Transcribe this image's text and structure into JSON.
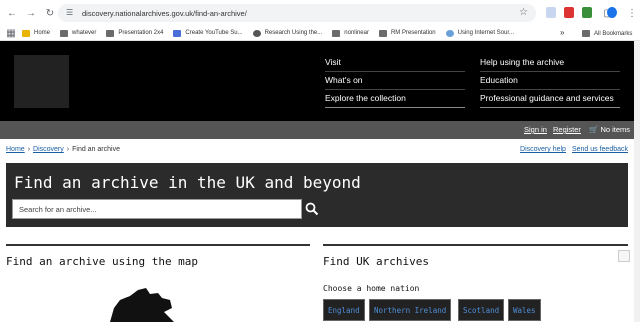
{
  "browser": {
    "url": "discovery.nationalarchives.gov.uk/find-an-archive/",
    "bookmarks": [
      {
        "label": "Home"
      },
      {
        "label": "whatever"
      },
      {
        "label": "Presentation 2x4"
      },
      {
        "label": "Create YouTube Su..."
      },
      {
        "label": "Research Using the..."
      },
      {
        "label": "nonlinear"
      },
      {
        "label": "RM Presentation"
      },
      {
        "label": "Using Internet Sour..."
      }
    ],
    "more_bookmarks": "»",
    "all_bookmarks": "All Bookmarks"
  },
  "header": {
    "nav_left": [
      "Visit",
      "What's on",
      "Explore the collection"
    ],
    "nav_right": [
      "Help using the archive",
      "Education",
      "Professional guidance and services"
    ]
  },
  "util": {
    "sign_in": "Sign in",
    "register": "Register",
    "basket": "No items"
  },
  "breadcrumb": {
    "home": "Home",
    "discovery": "Discovery",
    "current": "Find an archive"
  },
  "help_links": {
    "discovery_help": "Discovery help",
    "feedback": "Send us feedback"
  },
  "hero": {
    "title": "Find an archive in the UK and beyond",
    "search_placeholder": "Search for an archive..."
  },
  "map_section": {
    "title": "Find an archive using the map"
  },
  "uk_section": {
    "title": "Find UK archives",
    "choose_label": "Choose a home nation",
    "nations": [
      "England",
      "Northern Ireland",
      "Scotland",
      "Wales"
    ]
  }
}
